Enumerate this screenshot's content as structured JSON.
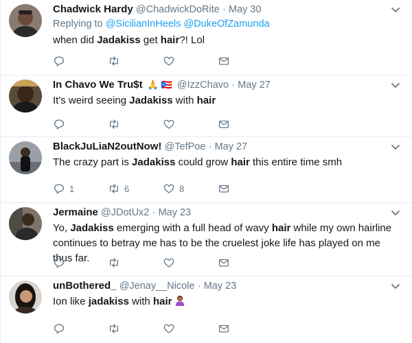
{
  "tweets": [
    {
      "name": "Chadwick Hardy",
      "handle": "@ChadwickDoRite",
      "date": "May 30",
      "reply_prefix": "Replying to ",
      "reply_user1": "@SicilianInHeels",
      "reply_user2": "@DukeOfZamunda",
      "text_parts": [
        "when did ",
        "Jadakiss",
        " get ",
        "hair",
        "?! Lol"
      ],
      "replies": "",
      "retweets": "",
      "likes": ""
    },
    {
      "name": "In Chavo We Tru$t",
      "flags": "🙏 🇵🇷",
      "handle": "@IzzChavo",
      "date": "May 27",
      "text_parts": [
        "It's weird seeing ",
        "Jadakiss",
        " with ",
        "hair",
        ""
      ],
      "replies": "",
      "retweets": "",
      "likes": ""
    },
    {
      "name": "BlackJuLiaN2outNow!",
      "handle": "@TefPoe",
      "date": "May 27",
      "text_parts": [
        "The crazy part is ",
        "Jadakiss",
        " could grow ",
        "hair",
        " this entire time smh"
      ],
      "replies": "1",
      "retweets": "6",
      "likes": "8"
    },
    {
      "name": "Jermaine",
      "handle": "@JDotUx2",
      "date": "May 23",
      "text_parts": [
        "Yo, ",
        "Jadakiss",
        " emerging with a full head of wavy ",
        "hair",
        " while my own hairline continues to betray me has to be the cruelest joke life has played on me thus far."
      ],
      "replies": "",
      "retweets": "",
      "likes": ""
    },
    {
      "name": "unBothered_",
      "handle": "@Jenay__Nicole",
      "date": "May 23",
      "text_parts": [
        "Ion like ",
        "jadakiss",
        " with ",
        "hair",
        ""
      ],
      "replies": "",
      "retweets": "",
      "likes": ""
    }
  ],
  "separator": "·",
  "icons": {
    "reply": "reply-icon",
    "retweet": "retweet-icon",
    "like": "heart-icon",
    "message": "envelope-icon",
    "caret": "chevron-down-icon"
  },
  "colors": {
    "link": "#1da1f2",
    "secondary": "#657786",
    "text": "#14171a",
    "border": "#e6ecf0"
  }
}
